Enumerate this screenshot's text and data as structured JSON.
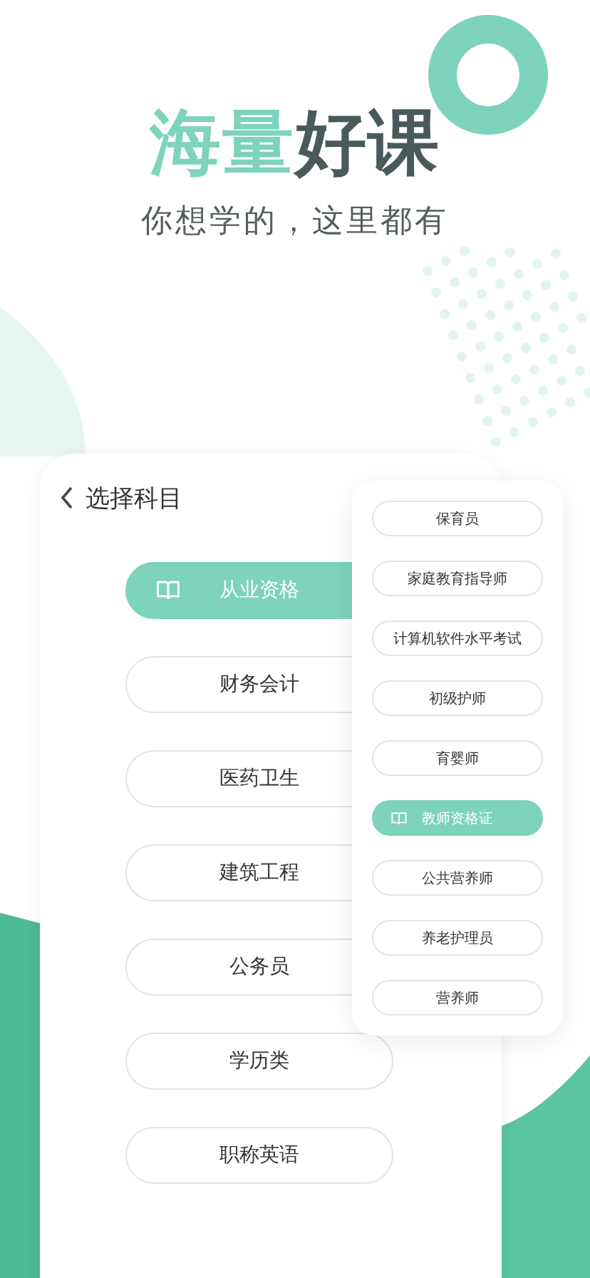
{
  "headline": {
    "accent": "海量",
    "rest": "好课"
  },
  "subtitle": "你想学的，这里都有",
  "screen": {
    "title": "选择科目",
    "categories": [
      {
        "label": "从业资格",
        "selected": true
      },
      {
        "label": "财务会计",
        "selected": false
      },
      {
        "label": "医药卫生",
        "selected": false
      },
      {
        "label": "建筑工程",
        "selected": false
      },
      {
        "label": "公务员",
        "selected": false
      },
      {
        "label": "学历类",
        "selected": false
      },
      {
        "label": "职称英语",
        "selected": false
      }
    ],
    "subcategories": [
      {
        "label": "保育员",
        "selected": false
      },
      {
        "label": "家庭教育指导师",
        "selected": false
      },
      {
        "label": "计算机软件水平考试",
        "selected": false
      },
      {
        "label": "初级护师",
        "selected": false
      },
      {
        "label": "育婴师",
        "selected": false
      },
      {
        "label": "教师资格证",
        "selected": true
      },
      {
        "label": "公共营养师",
        "selected": false
      },
      {
        "label": "养老护理员",
        "selected": false
      },
      {
        "label": "营养师",
        "selected": false
      }
    ]
  }
}
